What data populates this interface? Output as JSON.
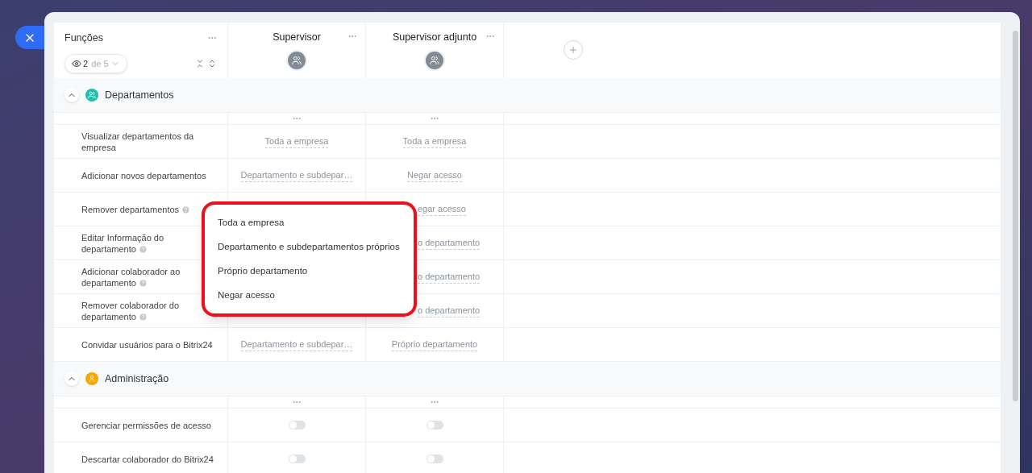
{
  "functions_header": {
    "title": "Funções",
    "visible_count": "2",
    "total": "de 5"
  },
  "roles": [
    {
      "name": "Supervisor"
    },
    {
      "name": "Supervisor adjunto"
    }
  ],
  "sections": [
    {
      "title": "Departamentos",
      "color": "#1fbfad",
      "kind": "group",
      "expanded": true,
      "rows": [
        {
          "label": "Visualizar departamentos da empresa",
          "help": false,
          "kind": "select",
          "under_dropdown": false,
          "values": [
            {
              "text": "Toda a empresa"
            },
            {
              "text": "Toda a empresa"
            }
          ]
        },
        {
          "label": "Adicionar novos departamentos",
          "help": false,
          "kind": "select",
          "under_dropdown": false,
          "values": [
            {
              "text": "Departamento e subdepar…"
            },
            {
              "text": "Negar acesso"
            }
          ]
        },
        {
          "label": "Remover departamentos",
          "help": true,
          "kind": "select",
          "under_dropdown": true,
          "values": [
            {
              "text": "egar acesso"
            }
          ]
        },
        {
          "label": "Editar Informação do departamento",
          "help": true,
          "kind": "select",
          "under_dropdown": true,
          "values": [
            {
              "text": "o departamento"
            }
          ]
        },
        {
          "label": "Adicionar colaborador ao departamento",
          "help": true,
          "kind": "select",
          "under_dropdown": true,
          "values": [
            {
              "text": "o departamento"
            }
          ]
        },
        {
          "label": "Remover colaborador do departamento",
          "help": true,
          "kind": "select",
          "under_dropdown": true,
          "values": [
            {
              "text": "o departamento"
            }
          ]
        },
        {
          "label": "Convidar usuários para o Bitrix24",
          "help": false,
          "kind": "select",
          "under_dropdown": false,
          "values": [
            {
              "text": "Departamento e subdepar…"
            },
            {
              "text": "Próprio departamento"
            }
          ]
        }
      ]
    },
    {
      "title": "Administração",
      "color": "#f7a700",
      "kind": "person",
      "expanded": true,
      "rows": [
        {
          "label": "Gerenciar permissões de acesso",
          "help": false,
          "kind": "toggle",
          "values": [
            {
              "on": false
            },
            {
              "on": false
            }
          ]
        },
        {
          "label": "Descartar colaborador do Bitrix24",
          "help": false,
          "kind": "toggle",
          "values": [
            {
              "on": false
            },
            {
              "on": false
            }
          ]
        }
      ]
    }
  ],
  "dropdown": {
    "options": [
      "Toda a empresa",
      "Departamento e subdepartamentos próprios",
      "Próprio departamento",
      "Negar acesso"
    ]
  }
}
